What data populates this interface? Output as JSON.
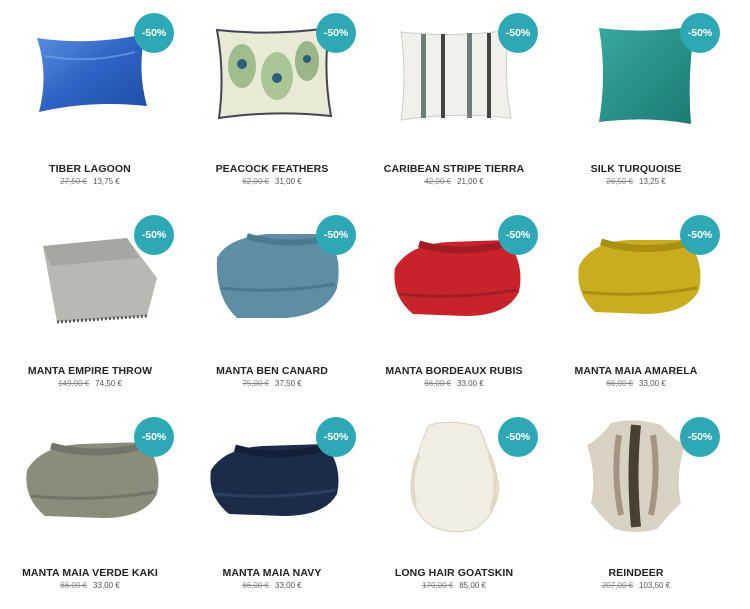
{
  "products": [
    {
      "name": "TIBER LAGOON",
      "old_price": "27,50 €",
      "price": "13,75 €",
      "discount": "-50%",
      "icon": "blue-satin-pillow"
    },
    {
      "name": "PEACOCK FEATHERS",
      "old_price": "62,00 €",
      "price": "31,00 €",
      "discount": "-50%",
      "icon": "peacock-feather-pillow"
    },
    {
      "name": "CARIBEAN STRIPE TIERRA",
      "old_price": "42,00 €",
      "price": "21,00 €",
      "discount": "-50%",
      "icon": "striped-pillow"
    },
    {
      "name": "SILK TURQUOISE",
      "old_price": "26,50 €",
      "price": "13,25 €",
      "discount": "-50%",
      "icon": "turquoise-silk-pillow"
    },
    {
      "name": "MANTA EMPIRE THROW",
      "old_price": "149,00 €",
      "price": "74,50 €",
      "discount": "-50%",
      "icon": "grey-throw"
    },
    {
      "name": "MANTA BEN CANARD",
      "old_price": "75,00 €",
      "price": "37,50 €",
      "discount": "-50%",
      "icon": "blue-blanket"
    },
    {
      "name": "MANTA BORDEAUX RUBIS",
      "old_price": "66,00 €",
      "price": "33,00 €",
      "discount": "-50%",
      "icon": "red-blanket"
    },
    {
      "name": "MANTA MAIA AMARELA",
      "old_price": "66,00 €",
      "price": "33,00 €",
      "discount": "-50%",
      "icon": "yellow-blanket"
    },
    {
      "name": "MANTA MAIA VERDE KAKI",
      "old_price": "66,00 €",
      "price": "33,00 €",
      "discount": "-50%",
      "icon": "khaki-blanket"
    },
    {
      "name": "MANTA MAIA NAVY",
      "old_price": "66,00 €",
      "price": "33,00 €",
      "discount": "-50%",
      "icon": "navy-blanket"
    },
    {
      "name": "LONG HAIR GOATSKIN",
      "old_price": "170,00 €",
      "price": "85,00 €",
      "discount": "-50%",
      "icon": "goatskin-rug"
    },
    {
      "name": "REINDEER",
      "old_price": "207,00 €",
      "price": "103,50 €",
      "discount": "-50%",
      "icon": "reindeer-hide"
    }
  ],
  "colors": {
    "badge": "#2fa8b6"
  }
}
